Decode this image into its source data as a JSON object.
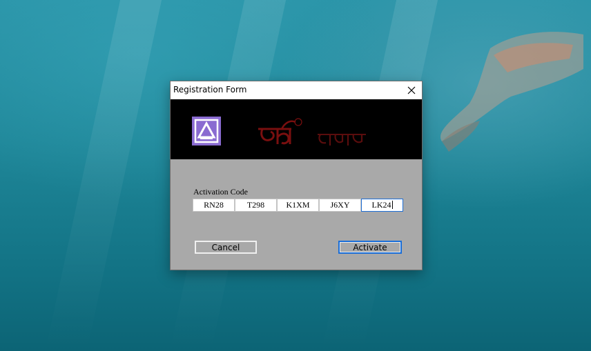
{
  "window": {
    "title": "Registration Form"
  },
  "banner": {
    "logo_icon": "app-logo-icon",
    "brand_mark": "bijoy-bayanno-logo",
    "background": "#000000",
    "brand_color": "#7a0f0f",
    "logo_color": "#8a6bd1"
  },
  "form": {
    "activation_label": "Activation Code",
    "code_fields": [
      {
        "value": "RN28"
      },
      {
        "value": "T298"
      },
      {
        "value": "K1XM"
      },
      {
        "value": "J6XY"
      },
      {
        "value": "LK24"
      }
    ],
    "active_field_index": 4
  },
  "buttons": {
    "cancel_label": "Cancel",
    "activate_label": "Activate"
  },
  "colors": {
    "dialog_body": "#a9a9a9",
    "focus_border": "#1e6ed6"
  }
}
